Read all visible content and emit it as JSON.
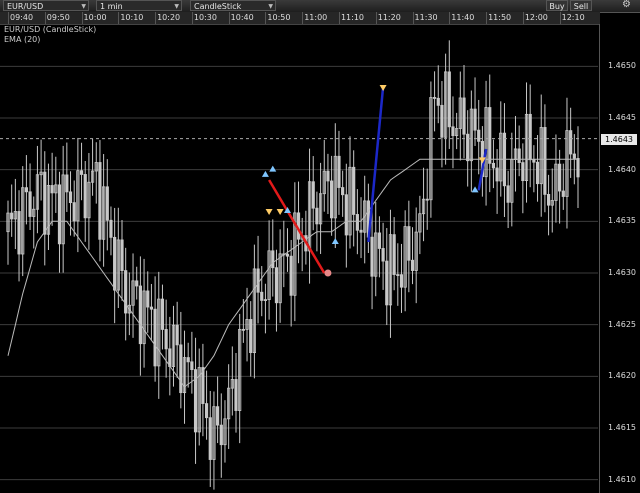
{
  "toolbar": {
    "symbol": "EUR/USD",
    "interval": "1 min",
    "chart_type": "CandleStick",
    "buy_label": "Buy",
    "sell_label": "Sell",
    "settings_icon": "gear-icon"
  },
  "legend": {
    "series_label": "EUR/USD (CandleStick)",
    "indicator_label": "EMA (20)"
  },
  "colors": {
    "background": "#000000",
    "candle": "#c8c8c8",
    "ema": "#bbbbbb",
    "gridline": "#3c3c3c",
    "red_trend": "#e21a1a",
    "blue_trend": "#1c28c8",
    "buy_marker": "#7fc6ff",
    "sell_marker": "#ffcc66",
    "exit_marker": "#e88888"
  },
  "chart_data": {
    "type": "candlestick",
    "title": "EUR/USD (CandleStick)",
    "time_ticks": [
      "09:40",
      "09:50",
      "10:00",
      "10:10",
      "10:20",
      "10:30",
      "10:40",
      "10:50",
      "11:00",
      "11:10",
      "11:20",
      "11:30",
      "11:40",
      "11:50",
      "12:00",
      "12:10"
    ],
    "y_ticks": [
      "1.4650",
      "1.4645",
      "1.4640",
      "1.4635",
      "1.4630",
      "1.4625",
      "1.4620",
      "1.4615",
      "1.4610"
    ],
    "ylim": [
      1.4609,
      1.4654
    ],
    "current_price": "1.4643",
    "current_price_value": 1.4643,
    "grid": true,
    "ema_period": 20,
    "x_minutes": [
      0,
      4,
      8,
      12,
      16,
      20,
      24,
      28,
      32,
      36,
      40,
      44,
      48,
      52,
      56,
      60,
      64,
      68,
      72,
      76,
      80,
      84,
      88,
      92,
      96,
      100,
      104,
      108,
      112,
      116,
      120,
      124,
      128,
      132,
      136,
      140,
      144,
      148,
      152,
      155
    ],
    "closes": [
      1.4634,
      1.4636,
      1.4638,
      1.4637,
      1.4637,
      1.4638,
      1.4639,
      1.4633,
      1.4628,
      1.4627,
      1.4625,
      1.4623,
      1.4621,
      1.4618,
      1.4614,
      1.4617,
      1.4624,
      1.4628,
      1.463,
      1.4631,
      1.4634,
      1.4637,
      1.4639,
      1.4637,
      1.4635,
      1.4632,
      1.463,
      1.4631,
      1.4634,
      1.4647,
      1.4645,
      1.4644,
      1.4643,
      1.4641,
      1.4639,
      1.4642,
      1.4641,
      1.4637,
      1.4641,
      1.4642
    ],
    "ema": [
      1.4622,
      1.4628,
      1.4633,
      1.4635,
      1.4635,
      1.4633,
      1.4631,
      1.4629,
      1.4627,
      1.4625,
      1.4623,
      1.4621,
      1.4619,
      1.462,
      1.4622,
      1.4625,
      1.4627,
      1.4629,
      1.4631,
      1.4632,
      1.4633,
      1.4634,
      1.4634,
      1.4635,
      1.4635,
      1.4637,
      1.4639,
      1.464,
      1.4641,
      1.4641,
      1.4641,
      1.4641,
      1.4641,
      1.4641,
      1.4641,
      1.4641,
      1.4641,
      1.4641,
      1.4641,
      1.4641
    ],
    "trend_lines": [
      {
        "color": "red",
        "x": [
          71,
          86
        ],
        "y": [
          1.4639,
          1.463
        ]
      },
      {
        "color": "blue",
        "x": [
          98,
          102
        ],
        "y": [
          1.4633,
          1.4648
        ]
      },
      {
        "color": "blue",
        "x": [
          128,
          130
        ],
        "y": [
          1.4638,
          1.4642
        ]
      }
    ],
    "markers": [
      {
        "kind": "buy",
        "x": 70,
        "y": 1.46395
      },
      {
        "kind": "buy",
        "x": 72,
        "y": 1.464
      },
      {
        "kind": "sell",
        "x": 71,
        "y": 1.4636
      },
      {
        "kind": "sell",
        "x": 74,
        "y": 1.4636
      },
      {
        "kind": "buy",
        "x": 76,
        "y": 1.4636
      },
      {
        "kind": "exit",
        "x": 87,
        "y": 1.463
      },
      {
        "kind": "buy",
        "x": 89,
        "y": 1.4633
      },
      {
        "kind": "sell",
        "x": 102,
        "y": 1.4648
      },
      {
        "kind": "buy",
        "x": 127,
        "y": 1.4638
      },
      {
        "kind": "sell",
        "x": 129,
        "y": 1.4641
      }
    ]
  }
}
